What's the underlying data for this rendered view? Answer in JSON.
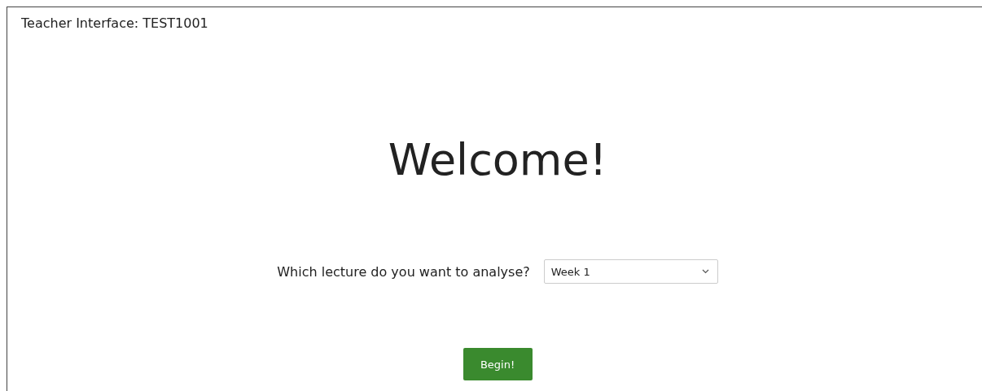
{
  "header": {
    "title": "Teacher Interface: TEST1001"
  },
  "heading": "Welcome!",
  "lecture_select": {
    "label": "Which lecture do you want to analyse?",
    "value": "Week 1"
  },
  "buttons": [
    "Begin!"
  ]
}
